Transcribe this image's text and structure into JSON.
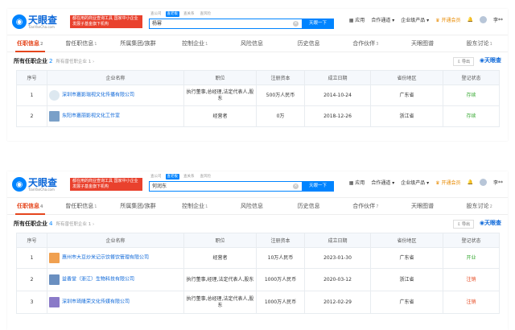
{
  "colors": {
    "accent": "#0084ff",
    "brand_red": "#e5461d",
    "ok": "#3aaa35"
  },
  "brand": {
    "name": "天眼查",
    "url": "TianYanCha.com",
    "slogan": "都在用的商业查询工具 国家中小企业发展子基金旗下机构"
  },
  "search": {
    "tabs": [
      "查公司",
      "查老板",
      "查关系",
      "查风险"
    ],
    "active_tab": 1,
    "search_button": "天眼一下"
  },
  "nav": {
    "app": "应用",
    "cooperate": "合作通道",
    "enterprise": "企业级产品",
    "vip": "开通会员",
    "user": "李**"
  },
  "screens": [
    {
      "query": "杨幂",
      "tabs": [
        {
          "label": "任职信息",
          "count": "2"
        },
        {
          "label": "曾任职信息",
          "count": "1"
        },
        {
          "label": "所属集团/族群",
          "count": ""
        },
        {
          "label": "控制企业",
          "count": "1"
        },
        {
          "label": "风险信息",
          "count": ""
        },
        {
          "label": "历史信息",
          "count": ""
        },
        {
          "label": "合作伙伴",
          "count": "3"
        },
        {
          "label": "天眼图谱",
          "count": ""
        },
        {
          "label": "股东讨论",
          "count": "1"
        }
      ],
      "section": {
        "title": "所有任职企业",
        "count": "2",
        "sub": "所有曾任职企业 1"
      },
      "export": "导出",
      "columns": [
        "序号",
        "企业名称",
        "职位",
        "注册资本",
        "成立日期",
        "省份地区",
        "登记状态"
      ],
      "rows": [
        {
          "no": "1",
          "name": "深圳市嘉影瑞视文化传播有限公司",
          "role": "执行董事,总经理,法定代表人,股东",
          "capital": "500万人民币",
          "date": "2014-10-24",
          "region": "广东省",
          "status": "存续",
          "status_type": "ok",
          "logo_color": "#dde8f0"
        },
        {
          "no": "2",
          "name": "东阳市嘉丽影视文化工作室",
          "role": "经营者",
          "capital": "0万",
          "date": "2018-12-26",
          "region": "浙江省",
          "status": "存续",
          "status_type": "ok",
          "logo_color": "#7aa0c8"
        }
      ]
    },
    {
      "query": "何润东",
      "tabs": [
        {
          "label": "任职信息",
          "count": "4"
        },
        {
          "label": "曾任职信息",
          "count": "1"
        },
        {
          "label": "所属集团/族群",
          "count": ""
        },
        {
          "label": "控制企业",
          "count": "1"
        },
        {
          "label": "风险信息",
          "count": ""
        },
        {
          "label": "历史信息",
          "count": ""
        },
        {
          "label": "合作伙伴",
          "count": "7"
        },
        {
          "label": "天眼图谱",
          "count": ""
        },
        {
          "label": "股东讨论",
          "count": "2"
        }
      ],
      "section": {
        "title": "所有任职企业",
        "count": "4",
        "sub": "所有曾任职企业 1"
      },
      "export": "导出",
      "columns": [
        "序号",
        "企业名称",
        "职位",
        "注册资本",
        "成立日期",
        "省份地区",
        "登记状态"
      ],
      "rows": [
        {
          "no": "1",
          "name": "惠州市大豆炒米记示饮餐饮管理有限公司",
          "role": "经营者",
          "capital": "10万人民币",
          "date": "2023-01-30",
          "region": "广东省",
          "status": "开业",
          "status_type": "ok",
          "logo_color": "#f0a050"
        },
        {
          "no": "2",
          "name": "益香堂（浙江）生物科技有限公司",
          "role": "执行董事,经理,法定代表人,股东",
          "capital": "1000万人民币",
          "date": "2020-03-12",
          "region": "浙江省",
          "status": "注销",
          "status_type": "bad",
          "logo_color": "#6a8fc0"
        },
        {
          "no": "3",
          "name": "深圳市琦隆荣文化传媒有限公司",
          "role": "执行董事,总经理,法定代表人,股东",
          "capital": "1000万人民币",
          "date": "2012-02-29",
          "region": "广东省",
          "status": "注销",
          "status_type": "bad",
          "logo_color": "#8a7ac8"
        }
      ]
    }
  ]
}
